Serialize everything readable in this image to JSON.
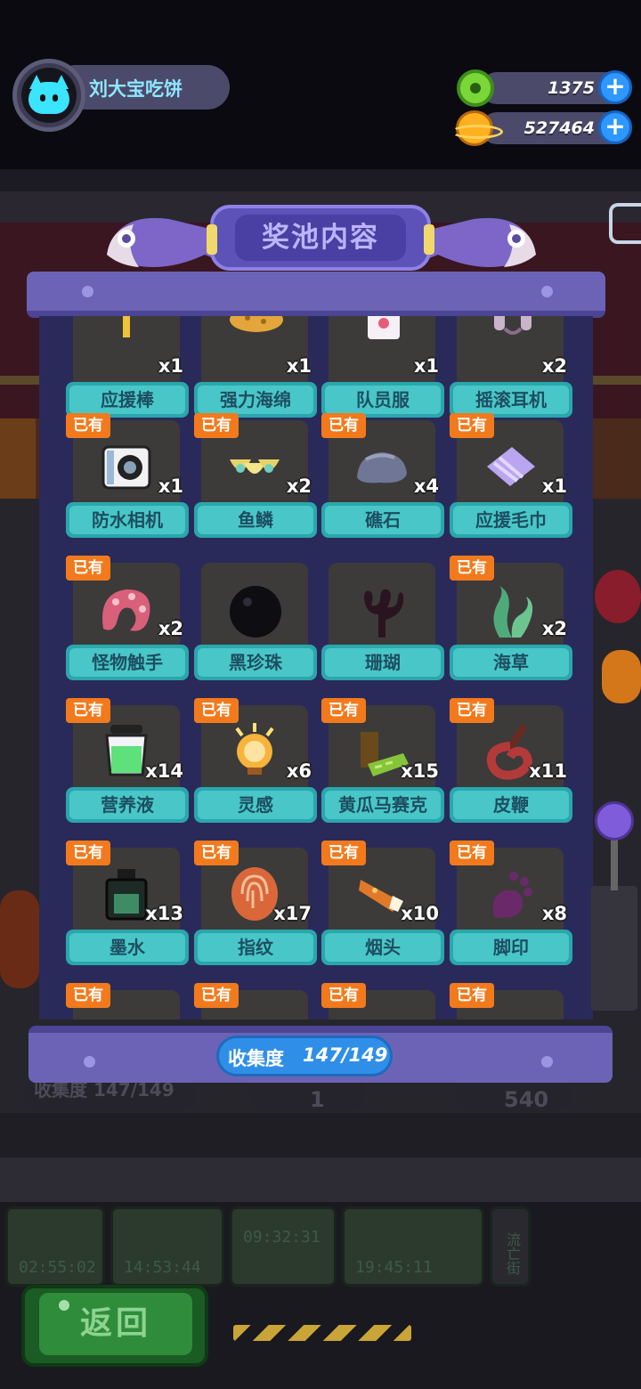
{
  "player": {
    "name": "刘大宝吃饼"
  },
  "currencies": [
    {
      "icon": "donut-coin-icon",
      "value": "1375",
      "color": "#7bd63a"
    },
    {
      "icon": "planet-coin-icon",
      "value": "527464",
      "color": "#ffb020"
    }
  ],
  "panel": {
    "title": "奖池内容",
    "progress_label": "收集度",
    "progress_value": "147/149"
  },
  "owned_badge": "已有",
  "rows": [
    [
      {
        "label": "应援棒",
        "qty": "x1",
        "owned": false,
        "icon": "cheer-stick-icon"
      },
      {
        "label": "强力海绵",
        "qty": "x1",
        "owned": false,
        "icon": "sponge-icon"
      },
      {
        "label": "队员服",
        "qty": "x1",
        "owned": false,
        "icon": "uniform-icon"
      },
      {
        "label": "摇滚耳机",
        "qty": "x2",
        "owned": false,
        "icon": "headphones-icon"
      }
    ],
    [
      {
        "label": "防水相机",
        "qty": "x1",
        "owned": true,
        "icon": "camera-icon"
      },
      {
        "label": "鱼鳞",
        "qty": "x2",
        "owned": true,
        "icon": "fish-scale-icon"
      },
      {
        "label": "礁石",
        "qty": "x4",
        "owned": true,
        "icon": "reef-rock-icon"
      },
      {
        "label": "应援毛巾",
        "qty": "x1",
        "owned": true,
        "icon": "towel-icon"
      }
    ],
    [
      {
        "label": "怪物触手",
        "qty": "x2",
        "owned": true,
        "icon": "tentacle-icon"
      },
      {
        "label": "黑珍珠",
        "qty": "",
        "owned": false,
        "icon": "black-pearl-icon"
      },
      {
        "label": "珊瑚",
        "qty": "",
        "owned": false,
        "icon": "coral-icon"
      },
      {
        "label": "海草",
        "qty": "x2",
        "owned": true,
        "icon": "seaweed-icon"
      }
    ],
    [
      {
        "label": "营养液",
        "qty": "x14",
        "owned": true,
        "icon": "nutrient-jar-icon"
      },
      {
        "label": "灵感",
        "qty": "x6",
        "owned": true,
        "icon": "bulb-icon"
      },
      {
        "label": "黄瓜马赛克",
        "qty": "x15",
        "owned": true,
        "icon": "cucumber-icon"
      },
      {
        "label": "皮鞭",
        "qty": "x11",
        "owned": true,
        "icon": "whip-icon"
      }
    ],
    [
      {
        "label": "墨水",
        "qty": "x13",
        "owned": true,
        "icon": "ink-bottle-icon"
      },
      {
        "label": "指纹",
        "qty": "x17",
        "owned": true,
        "icon": "fingerprint-icon"
      },
      {
        "label": "烟头",
        "qty": "x10",
        "owned": true,
        "icon": "cigarette-icon"
      },
      {
        "label": "脚印",
        "qty": "x8",
        "owned": true,
        "icon": "footprint-icon"
      }
    ],
    [
      {
        "label": "",
        "qty": "",
        "owned": true,
        "icon": "partial-item-icon"
      },
      {
        "label": "",
        "qty": "",
        "owned": true,
        "icon": "partial-item-icon"
      },
      {
        "label": "",
        "qty": "",
        "owned": true,
        "icon": "partial-item-icon"
      },
      {
        "label": "",
        "qty": "",
        "owned": true,
        "icon": "partial-item-icon"
      }
    ]
  ],
  "background": {
    "under_progress": "收集度 147/149",
    "under_count_a": "1",
    "under_count_b": "540",
    "timers": [
      "02:55:02",
      "14:53:44",
      "09:32:31",
      "19:45:11"
    ],
    "side_sign": "流亡街"
  },
  "back_button": "返回"
}
